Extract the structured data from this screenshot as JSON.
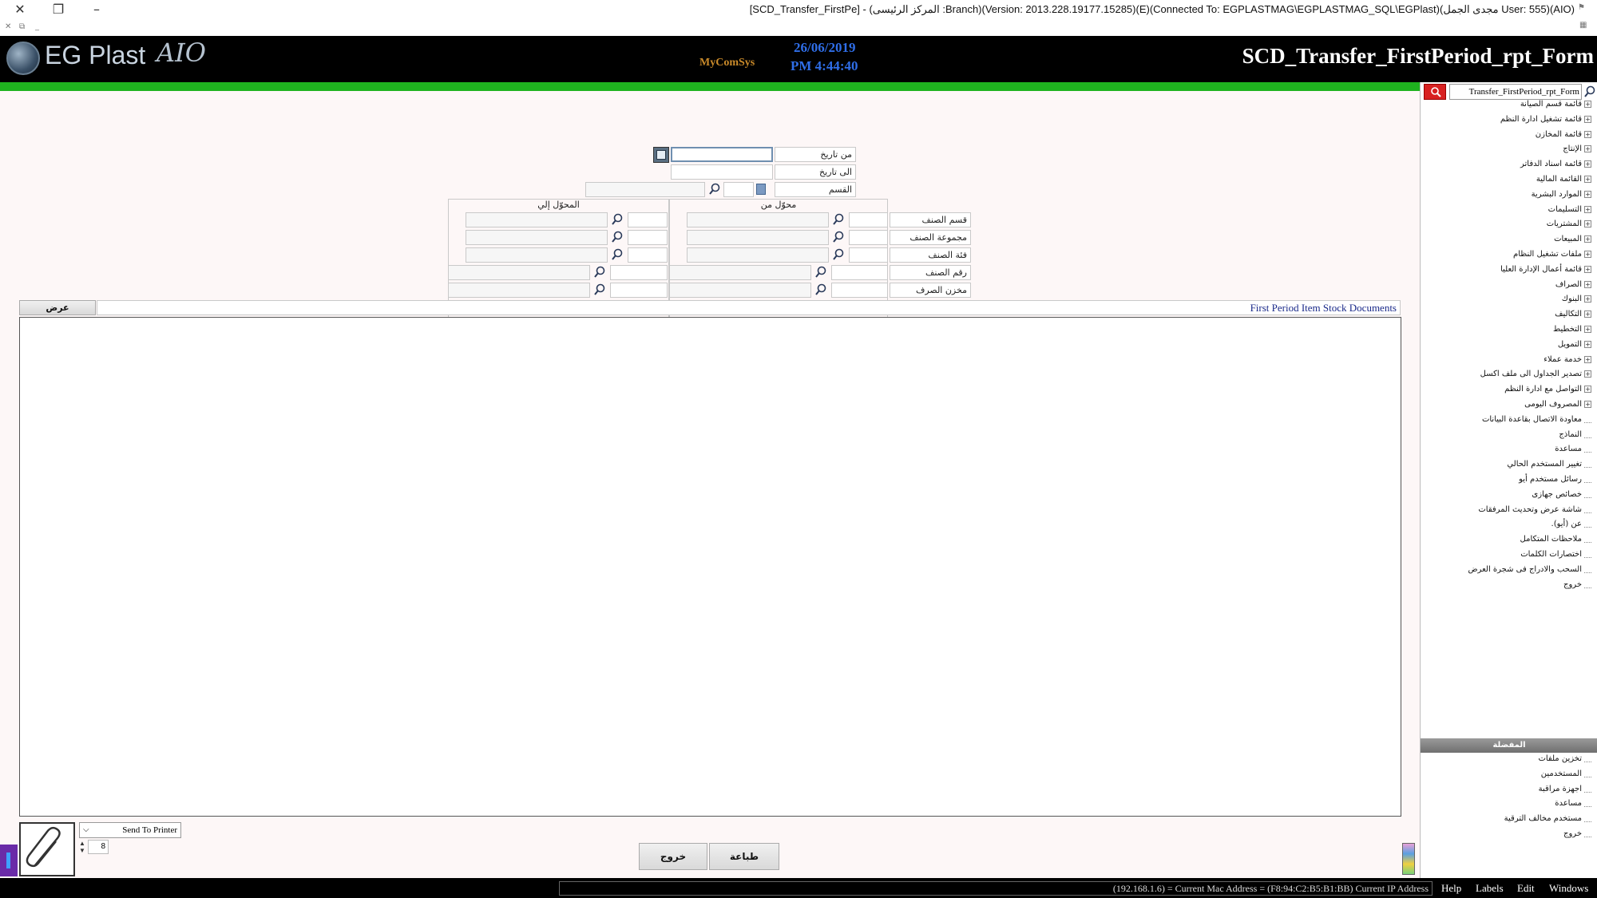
{
  "window": {
    "title": "[SCD_Transfer_FirstPe] - (المركز الرئيسى :Branch)(Version: 2013.228.19177.15285)(E)(Connected To: EGPLASTMAG\\EGPLASTMAG_SQL\\EGPlast)(مجدى الجمل User: 555)(AIO)"
  },
  "header": {
    "logo_text": "EG Plast",
    "logo_suffix": "AIO",
    "mycomsys": "MyComSys",
    "date": "26/06/2019",
    "time": "PM 4:44:40",
    "form_title": "SCD_Transfer_FirstPeriod_rpt_Form"
  },
  "form": {
    "from_date_label": "من تاريخ",
    "to_date_label": "الى تاريخ",
    "department_label": "القسم",
    "group_from": "محوّل من",
    "group_to": "المحوّل إلي",
    "rows": [
      {
        "label": "قسم الصنف"
      },
      {
        "label": "مجموعة الصنف"
      },
      {
        "label": "فئة الصنف"
      },
      {
        "label": "رقم الصنف"
      },
      {
        "label": "مخزن الصرف"
      }
    ],
    "view_button": "عرض",
    "report_caption": "First Period Item Stock Documents"
  },
  "bottom": {
    "printer_option": "Send To Printer",
    "copies": "8",
    "print_button": "طباعة",
    "exit_button": "خروج"
  },
  "sidebar": {
    "search_value": "Transfer_FirstPeriod_rpt_Form",
    "tree": [
      {
        "label": "قائمة قسم الصيانة",
        "expandable": true
      },
      {
        "label": "قائمة تشغيل ادارة النظم",
        "expandable": true
      },
      {
        "label": "قائمة المخازن",
        "expandable": true
      },
      {
        "label": "الإنتاج",
        "expandable": true
      },
      {
        "label": "قائمة اسناد الدفاتر",
        "expandable": true
      },
      {
        "label": "القائمة المالية",
        "expandable": true
      },
      {
        "label": "الموارد البشرية",
        "expandable": true
      },
      {
        "label": "التسليمات",
        "expandable": true
      },
      {
        "label": "المشتريات",
        "expandable": true
      },
      {
        "label": "المبيعات",
        "expandable": true
      },
      {
        "label": "ملفات تشغيل النظام",
        "expandable": true
      },
      {
        "label": "قائمة أعمال الإدارة العليا",
        "expandable": true
      },
      {
        "label": "الصراف",
        "expandable": true
      },
      {
        "label": "البنوك",
        "expandable": true
      },
      {
        "label": "التكاليف",
        "expandable": true
      },
      {
        "label": "التخطيط",
        "expandable": true
      },
      {
        "label": "التمويل",
        "expandable": true
      },
      {
        "label": "خدمة عملاء",
        "expandable": true
      },
      {
        "label": "تصدير الجداول الى ملف اكسل",
        "expandable": true
      },
      {
        "label": "التواصل مع ادارة النظم",
        "expandable": true
      },
      {
        "label": "المصروف اليومى",
        "expandable": true
      },
      {
        "label": "معاودة الاتصال بقاعدة البيانات",
        "expandable": false
      },
      {
        "label": "النماذج",
        "expandable": false
      },
      {
        "label": "مساعدة",
        "expandable": false
      },
      {
        "label": "تغيير المستخدم الحالي",
        "expandable": false
      },
      {
        "label": "رسائل مستخدم أيو",
        "expandable": false
      },
      {
        "label": "خصائص جهازى",
        "expandable": false
      },
      {
        "label": "شاشة عرض وتحديث المرفقات",
        "expandable": false
      },
      {
        "label": "عن (أيو).",
        "expandable": false
      },
      {
        "label": "ملاحظات المتكامل",
        "expandable": false
      },
      {
        "label": "اختصارات الكلمات",
        "expandable": false
      },
      {
        "label": "السحب والادراج فى شجرة العرض",
        "expandable": false
      },
      {
        "label": "خروج",
        "expandable": false
      }
    ],
    "favorites_title": "المفضلة",
    "favorites": [
      {
        "label": "تخزين ملفات"
      },
      {
        "label": "المستخدمين"
      },
      {
        "label": "اجهزة مراقبة"
      },
      {
        "label": "مساعدة"
      },
      {
        "label": "مستخدم مخالف الترقية"
      },
      {
        "label": "خروج"
      }
    ]
  },
  "statusbar": {
    "text": "(192.168.1.6) = Current Mac Address = (F8:94:C2:B5:B1:BB) Current IP Address",
    "menu": [
      "Help",
      "Labels",
      "Edit",
      "Windows"
    ]
  },
  "colors": {
    "header_bg": "#000000",
    "accent_green": "#1fb31f",
    "datetime_blue": "#2f6ee8",
    "caption_blue": "#1a2a8a"
  }
}
